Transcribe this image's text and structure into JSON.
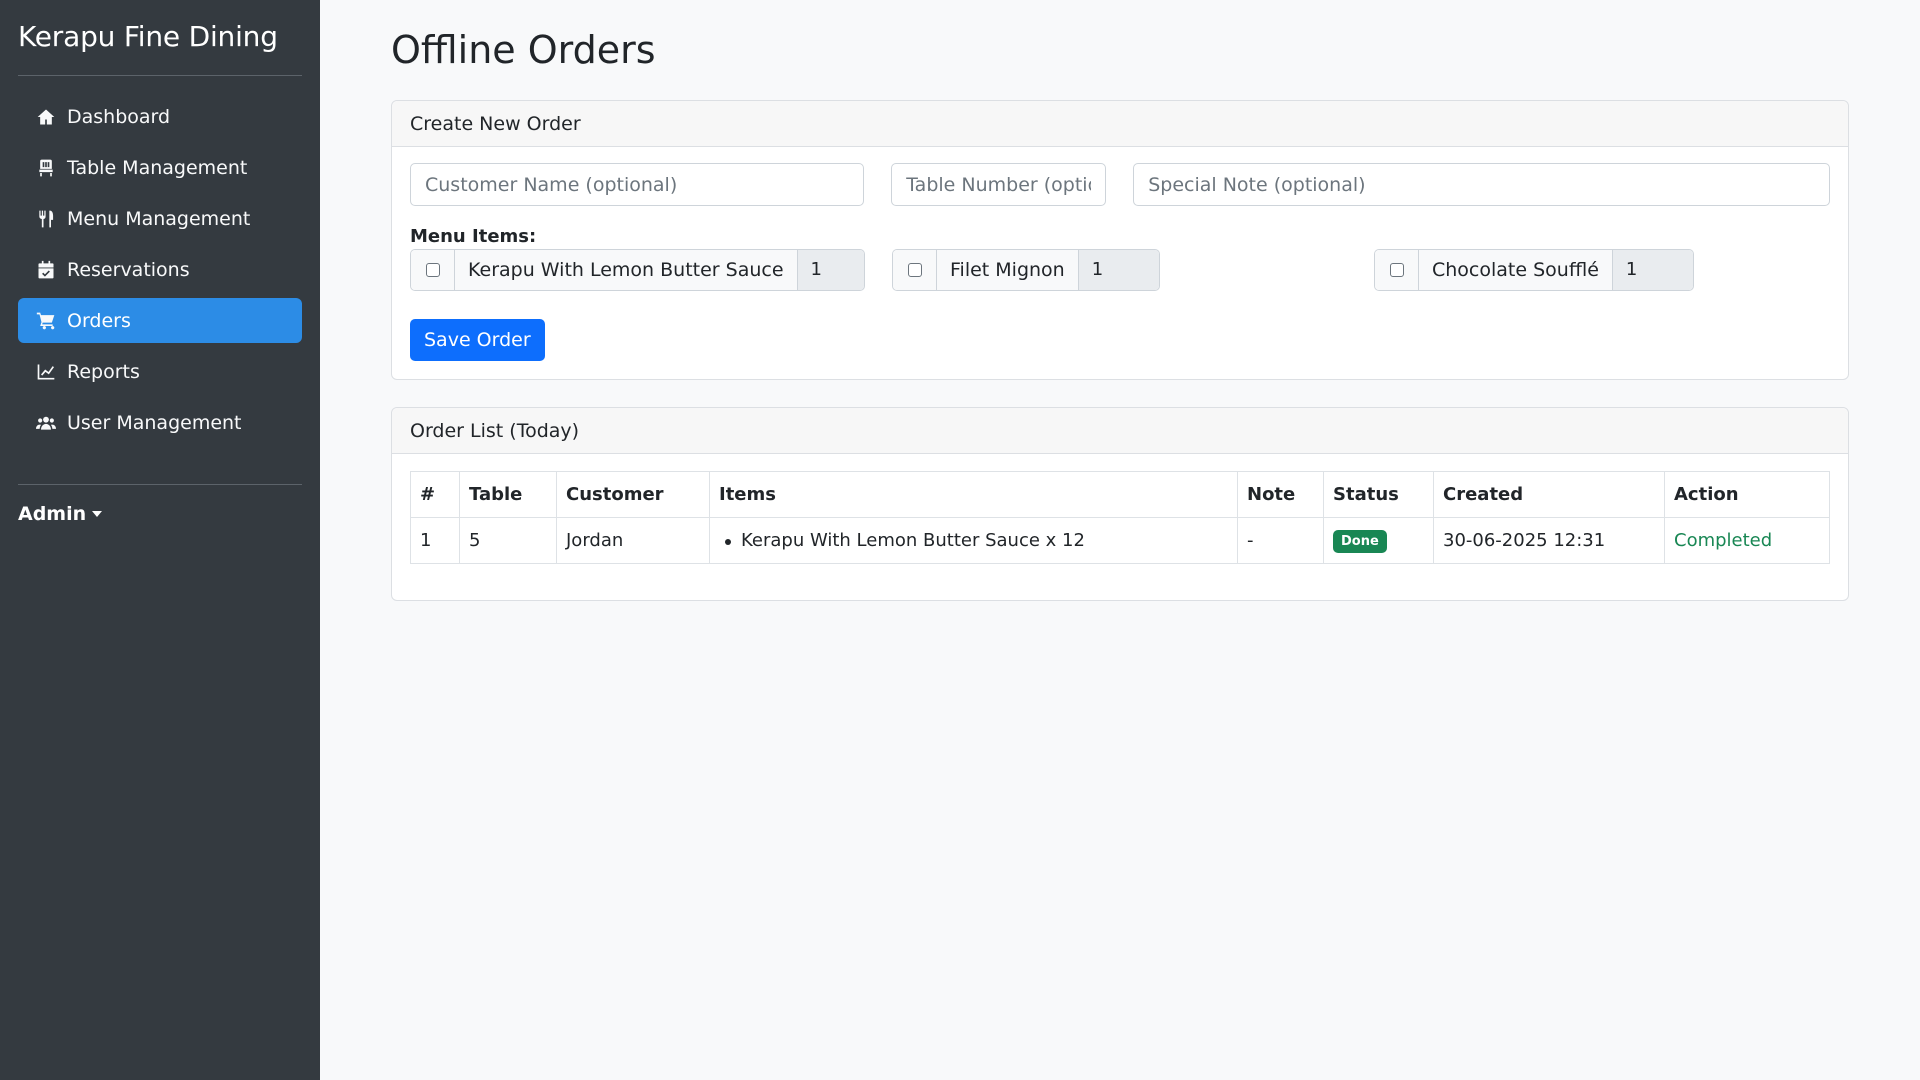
{
  "sidebar": {
    "brand": "Kerapu Fine Dining",
    "items": [
      {
        "label": "Dashboard",
        "icon": "home-icon"
      },
      {
        "label": "Table Management",
        "icon": "chair-icon"
      },
      {
        "label": "Menu Management",
        "icon": "utensils-icon"
      },
      {
        "label": "Reservations",
        "icon": "calendar-icon"
      },
      {
        "label": "Orders",
        "icon": "cart-icon",
        "active": true
      },
      {
        "label": "Reports",
        "icon": "chart-line-icon"
      },
      {
        "label": "User Management",
        "icon": "users-icon"
      }
    ],
    "admin_label": "Admin"
  },
  "page": {
    "title": "Offline Orders"
  },
  "create_order": {
    "header": "Create New Order",
    "customer_placeholder": "Customer Name (optional)",
    "table_placeholder": "Table Number (optional)",
    "note_placeholder": "Special Note (optional)",
    "menu_items_label": "Menu Items:",
    "menu_items": [
      {
        "name": "Kerapu With Lemon Butter Sauce",
        "qty": "1"
      },
      {
        "name": "Filet Mignon",
        "qty": "1"
      },
      {
        "name": "Chocolate Soufflé",
        "qty": "1"
      }
    ],
    "save_label": "Save Order"
  },
  "order_list": {
    "header": "Order List (Today)",
    "columns": [
      "#",
      "Table",
      "Customer",
      "Items",
      "Note",
      "Status",
      "Created",
      "Action"
    ],
    "rows": [
      {
        "num": "1",
        "table": "5",
        "customer": "Jordan",
        "item": "Kerapu With Lemon Butter Sauce x 12",
        "note": "-",
        "status": "Done",
        "created": "30-06-2025 12:31",
        "action": "Completed"
      }
    ]
  },
  "colors": {
    "sidebar_bg": "#343a40",
    "active_item": "#2c8ce6",
    "primary": "#0d6efd",
    "success": "#198754"
  }
}
